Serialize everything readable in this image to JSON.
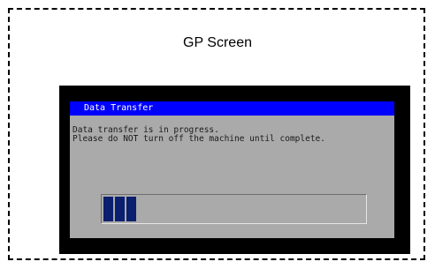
{
  "screen": {
    "label": "GP Screen"
  },
  "dialog": {
    "title": "Data Transfer",
    "message_line1": "Data transfer is in progress.",
    "message_line2": "Please do NOT turn off the machine until complete."
  },
  "progress": {
    "filled_blocks": 3,
    "fraction": 0.12,
    "fill_color": "#0a1f6e"
  },
  "colors": {
    "titlebar": "#0000ff",
    "dialog_bg": "#aaaaaa",
    "bezel": "#000000"
  }
}
